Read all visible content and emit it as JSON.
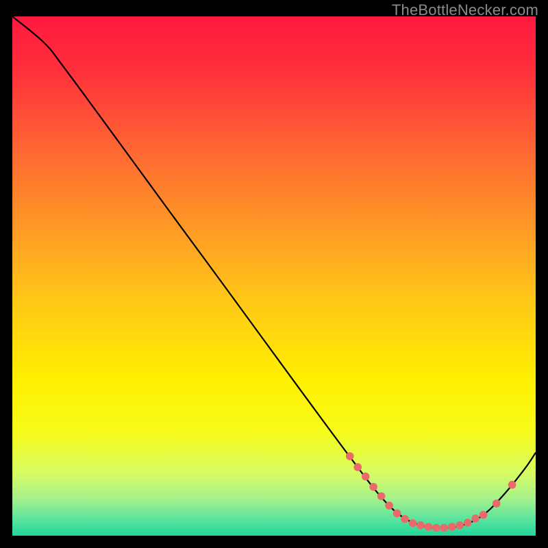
{
  "attribution": "TheBottleNecker.com",
  "chart_data": {
    "type": "line",
    "title": "",
    "xlabel": "",
    "ylabel": "",
    "xlim": [
      0,
      100
    ],
    "ylim": [
      0,
      100
    ],
    "curve": [
      {
        "x": 0,
        "y": 100
      },
      {
        "x": 6,
        "y": 95
      },
      {
        "x": 10,
        "y": 90
      },
      {
        "x": 20,
        "y": 76.3
      },
      {
        "x": 30,
        "y": 62.5
      },
      {
        "x": 40,
        "y": 48.8
      },
      {
        "x": 50,
        "y": 35
      },
      {
        "x": 58,
        "y": 24
      },
      {
        "x": 65,
        "y": 14.5
      },
      {
        "x": 70,
        "y": 8
      },
      {
        "x": 74,
        "y": 4
      },
      {
        "x": 78,
        "y": 2
      },
      {
        "x": 82,
        "y": 1.5
      },
      {
        "x": 86,
        "y": 2
      },
      {
        "x": 90,
        "y": 4
      },
      {
        "x": 94,
        "y": 8
      },
      {
        "x": 98,
        "y": 13
      },
      {
        "x": 100,
        "y": 16
      }
    ],
    "markers": [
      {
        "x": 64.5,
        "y": 15.3
      },
      {
        "x": 66,
        "y": 13.2
      },
      {
        "x": 67.5,
        "y": 11.4
      },
      {
        "x": 69,
        "y": 9.4
      },
      {
        "x": 70.5,
        "y": 7.6
      },
      {
        "x": 72,
        "y": 5.8
      },
      {
        "x": 73.5,
        "y": 4.3
      },
      {
        "x": 75,
        "y": 3.2
      },
      {
        "x": 76.5,
        "y": 2.4
      },
      {
        "x": 78,
        "y": 2.0
      },
      {
        "x": 79.5,
        "y": 1.7
      },
      {
        "x": 81,
        "y": 1.5
      },
      {
        "x": 82.5,
        "y": 1.5
      },
      {
        "x": 84,
        "y": 1.7
      },
      {
        "x": 85.5,
        "y": 2.0
      },
      {
        "x": 87,
        "y": 2.5
      },
      {
        "x": 88.5,
        "y": 3.3
      },
      {
        "x": 90,
        "y": 4.0
      },
      {
        "x": 92.5,
        "y": 6.2
      },
      {
        "x": 95.5,
        "y": 9.8
      }
    ],
    "background_gradient_stops": [
      {
        "offset": 0.0,
        "color": "#ff193f"
      },
      {
        "offset": 0.1,
        "color": "#ff2e3b"
      },
      {
        "offset": 0.25,
        "color": "#ff6433"
      },
      {
        "offset": 0.4,
        "color": "#ff9726"
      },
      {
        "offset": 0.55,
        "color": "#ffc816"
      },
      {
        "offset": 0.7,
        "color": "#fff000"
      },
      {
        "offset": 0.8,
        "color": "#f6fb19"
      },
      {
        "offset": 0.88,
        "color": "#d7fb63"
      },
      {
        "offset": 0.93,
        "color": "#a3f18b"
      },
      {
        "offset": 0.97,
        "color": "#57e39e"
      },
      {
        "offset": 1.0,
        "color": "#22d79a"
      }
    ],
    "marker_color": "#e86a6a",
    "line_color": "#000000"
  }
}
